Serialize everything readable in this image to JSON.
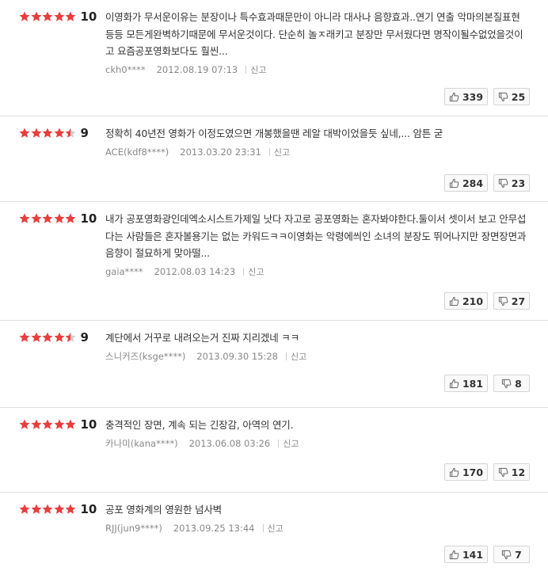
{
  "colors": {
    "star_filled": "#ea3d3d",
    "star_empty": "#cccccc"
  },
  "reviews": [
    {
      "rating": 10,
      "score_label": "10",
      "text": "이영화가 무서운이유는 분장이나 특수효과때문만이 아니라 대사나 음향효과..연기 연출 악마의본질표현등등 모든게완벽하기때문에 무서운것이다. 단순히 놀ㅈ래키고 분장만 무서웠다면 명작이될수없었을것이고 요즘공포영화보다도 훨씬...",
      "user": "ckh0****",
      "date": "2012.08.19 07:13",
      "report": "신고",
      "up": "339",
      "down": "25"
    },
    {
      "rating": 9,
      "score_label": "9",
      "text": "정확히 40년전 영화가 이정도였으면 개봉했을땐 레알 대박이었을듯 싶네,... 암튼 굳",
      "user": "ACE(kdf8****)",
      "date": "2013.03.20 23:31",
      "report": "신고",
      "up": "284",
      "down": "23"
    },
    {
      "rating": 10,
      "score_label": "10",
      "text": "내가 공포영화광인데엑소시스트가제일 낫다 자고로 공포영화는 혼자봐야한다.둘이서 셋이서 보고 안무섭다는 사람들은 혼자볼용기는 없는 카워드ㅋㅋ이영화는 악령에씌인 소녀의 분장도 뛰어나지만 장면장면과 음향이 절묘하게 맞아떨...",
      "user": "gaia****",
      "date": "2012.08.03 14:23",
      "report": "신고",
      "up": "210",
      "down": "27"
    },
    {
      "rating": 9,
      "score_label": "9",
      "text": "계단에서 거꾸로 내려오는거 진짜 지리겠네 ㅋㅋ",
      "user": "스니커즈(ksge****)",
      "date": "2013.09.30 15:28",
      "report": "신고",
      "up": "181",
      "down": "8"
    },
    {
      "rating": 10,
      "score_label": "10",
      "text": "충격적인 장면, 계속 되는 긴장감, 아역의 연기.",
      "user": "카나미(kana****)",
      "date": "2013.06.08 03:26",
      "report": "신고",
      "up": "170",
      "down": "12"
    },
    {
      "rating": 10,
      "score_label": "10",
      "text": "공포 영화계의 영원한 넘사벽",
      "user": "RJJ(jun9****)",
      "date": "2013.09.25 13:44",
      "report": "신고",
      "up": "141",
      "down": "7"
    }
  ]
}
